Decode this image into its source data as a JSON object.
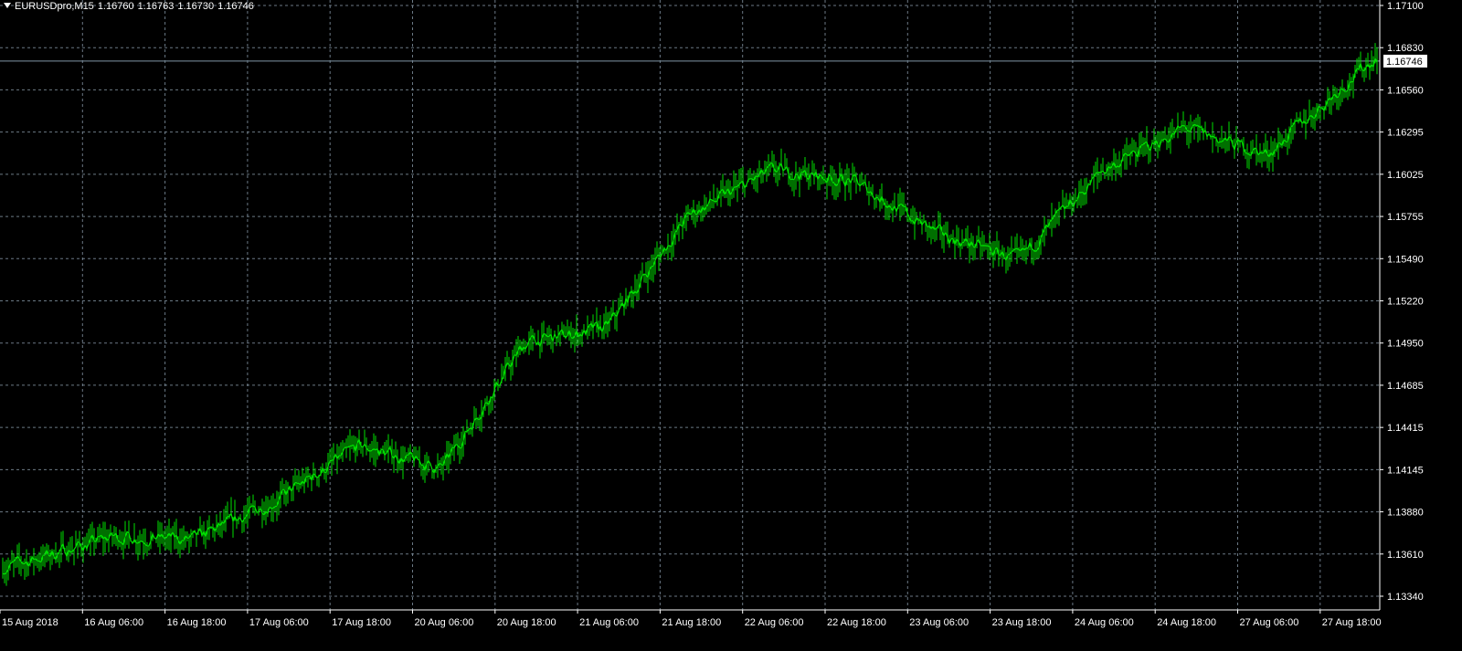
{
  "header": {
    "symbol": "EURUSDpro,M15",
    "open": "1.16760",
    "high": "1.16763",
    "low": "1.16730",
    "close": "1.16746"
  },
  "price_axis": {
    "ticks": [
      "1.17100",
      "1.16830",
      "1.16560",
      "1.16295",
      "1.16025",
      "1.15755",
      "1.15490",
      "1.15220",
      "1.14950",
      "1.14685",
      "1.14415",
      "1.14145",
      "1.13880",
      "1.13610",
      "1.13340"
    ],
    "current_price_label": "1.16746"
  },
  "time_axis": {
    "ticks": [
      "15 Aug 2018",
      "16 Aug 06:00",
      "16 Aug 18:00",
      "17 Aug 06:00",
      "17 Aug 18:00",
      "20 Aug 06:00",
      "20 Aug 18:00",
      "21 Aug 06:00",
      "21 Aug 18:00",
      "22 Aug 06:00",
      "22 Aug 18:00",
      "23 Aug 06:00",
      "23 Aug 18:00",
      "24 Aug 06:00",
      "24 Aug 18:00",
      "27 Aug 06:00",
      "27 Aug 18:00"
    ]
  },
  "colors": {
    "background": "#000000",
    "grid": "#8fa2b2",
    "bars": "#00e000",
    "bid_line": "#7f96a6",
    "axis_text": "#ffffff",
    "price_label_bg": "#ffffff",
    "price_label_text": "#000000"
  },
  "chart_data": {
    "type": "line",
    "title": "EURUSDpro,M15",
    "ylim": [
      1.1325,
      1.1715
    ],
    "series": [
      {
        "name": "EURUSDpro",
        "x": [
          "15 Aug 2018",
          "16 Aug 06:00",
          "16 Aug 18:00",
          "17 Aug 06:00",
          "17 Aug 18:00",
          "20 Aug 06:00",
          "20 Aug 18:00",
          "21 Aug 06:00",
          "21 Aug 18:00",
          "22 Aug 06:00",
          "22 Aug 18:00",
          "23 Aug 06:00",
          "23 Aug 18:00",
          "24 Aug 06:00",
          "24 Aug 18:00",
          "27 Aug 06:00",
          "27 Aug 18:00"
        ],
        "values": [
          1.1352,
          1.1372,
          1.137,
          1.1395,
          1.143,
          1.1415,
          1.1495,
          1.1505,
          1.1577,
          1.1605,
          1.1598,
          1.1565,
          1.1548,
          1.1605,
          1.1632,
          1.1615,
          1.1678
        ]
      }
    ]
  }
}
